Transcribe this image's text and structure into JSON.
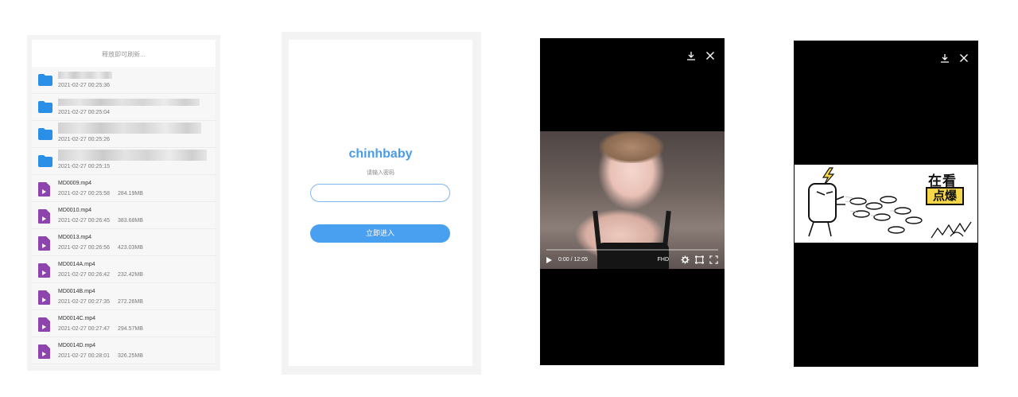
{
  "file_list": {
    "refresh_text": "释放即可刷新...",
    "folders": [
      {
        "date": "2021-02-27 00:25:36"
      },
      {
        "date": "2021-02-27 00:25:04"
      },
      {
        "date": "2021-02-27 00:25:26"
      },
      {
        "date": "2021-02-27 00:25:15"
      }
    ],
    "files": [
      {
        "name": "MD0009.mp4",
        "date": "2021-02-27 00:25:58",
        "size": "284.19MB"
      },
      {
        "name": "MD0010.mp4",
        "date": "2021-02-27 00:26:45",
        "size": "383.68MB"
      },
      {
        "name": "MD0013.mp4",
        "date": "2021-02-27 00:26:56",
        "size": "423.03MB"
      },
      {
        "name": "MD0014A.mp4",
        "date": "2021-02-27 00:26:42",
        "size": "232.42MB"
      },
      {
        "name": "MD0014B.mp4",
        "date": "2021-02-27 00:27:35",
        "size": "272.26MB"
      },
      {
        "name": "MD0014C.mp4",
        "date": "2021-02-27 00:27:47",
        "size": "294.57MB"
      },
      {
        "name": "MD0014D.mp4",
        "date": "2021-02-27 00:28:01",
        "size": "326.25MB"
      }
    ],
    "colors": {
      "folder": "#2a8fe6",
      "video_file": "#8e44ad"
    }
  },
  "login": {
    "brand": "chinhbaby",
    "hint": "请输入密码",
    "password_placeholder": "",
    "enter_label": "立即进入",
    "colors": {
      "brand": "#4a9be8",
      "button": "#4aa0f0"
    }
  },
  "player": {
    "time": "0:00 / 12:05",
    "quality": "FHD",
    "progress_fraction": 0.0,
    "icons": [
      "download-icon",
      "close-icon",
      "play-icon",
      "settings-icon",
      "pip-icon",
      "fullscreen-icon"
    ]
  },
  "sticker_view": {
    "text_line1": "在看",
    "text_line2": "点爆",
    "icons": [
      "download-icon",
      "close-icon"
    ]
  }
}
